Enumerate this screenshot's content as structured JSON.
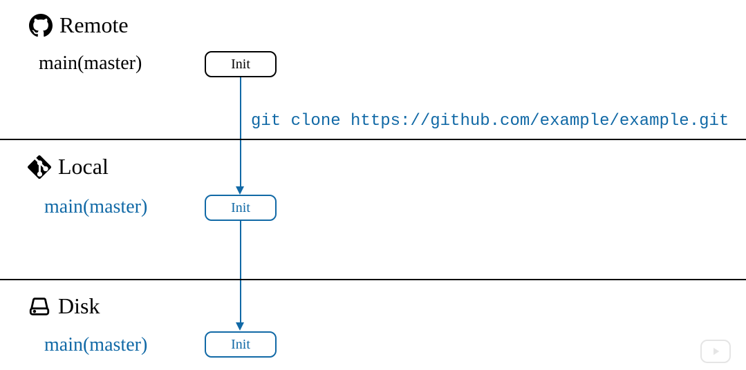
{
  "sections": {
    "remote": {
      "title": "Remote",
      "branch": "main(master)",
      "commit": "Init"
    },
    "local": {
      "title": "Local",
      "branch": "main(master)",
      "commit": "Init"
    },
    "disk": {
      "title": "Disk",
      "branch": "main(master)",
      "commit": "Init"
    }
  },
  "command": "git clone https://github.com/example/example.git",
  "colors": {
    "accent": "#1169a6"
  }
}
